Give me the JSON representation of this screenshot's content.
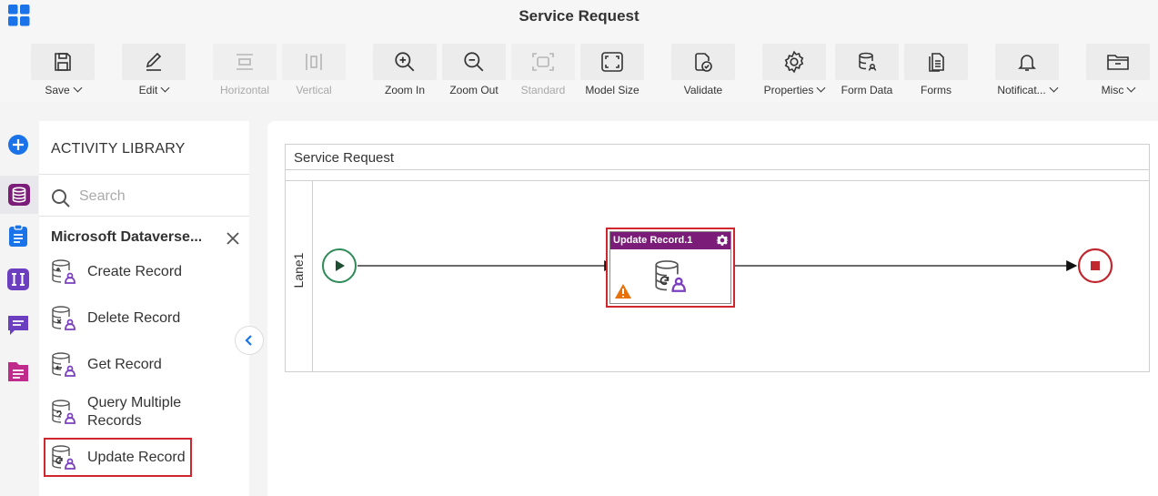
{
  "app": {
    "title": "Service Request"
  },
  "toolbar": {
    "save": "Save",
    "edit": "Edit",
    "horizontal": "Horizontal",
    "vertical": "Vertical",
    "zoom_in": "Zoom In",
    "zoom_out": "Zoom Out",
    "standard": "Standard",
    "model_size": "Model Size",
    "validate": "Validate",
    "properties": "Properties",
    "form_data": "Form Data",
    "forms": "Forms",
    "notifications": "Notificat...",
    "misc": "Misc"
  },
  "library": {
    "title": "ACTIVITY LIBRARY",
    "search_placeholder": "Search",
    "category": "Microsoft Dataverse...",
    "items": [
      {
        "label": "Create Record",
        "icon": "database-create-icon"
      },
      {
        "label": "Delete Record",
        "icon": "database-delete-icon"
      },
      {
        "label": "Get Record",
        "icon": "database-get-icon"
      },
      {
        "label": "Query Multiple Records",
        "icon": "database-query-icon"
      },
      {
        "label": "Update Record",
        "icon": "database-update-icon",
        "highlighted": true
      }
    ]
  },
  "canvas": {
    "pool_title": "Service Request",
    "lane_label": "Lane1",
    "activity": {
      "title": "Update Record.1",
      "warning": true,
      "selected": true
    }
  },
  "colors": {
    "accent": "#7b1c78",
    "highlight": "#d0272e",
    "start": "#2e8b57",
    "end": "#c0272e",
    "warning": "#e8710a"
  }
}
